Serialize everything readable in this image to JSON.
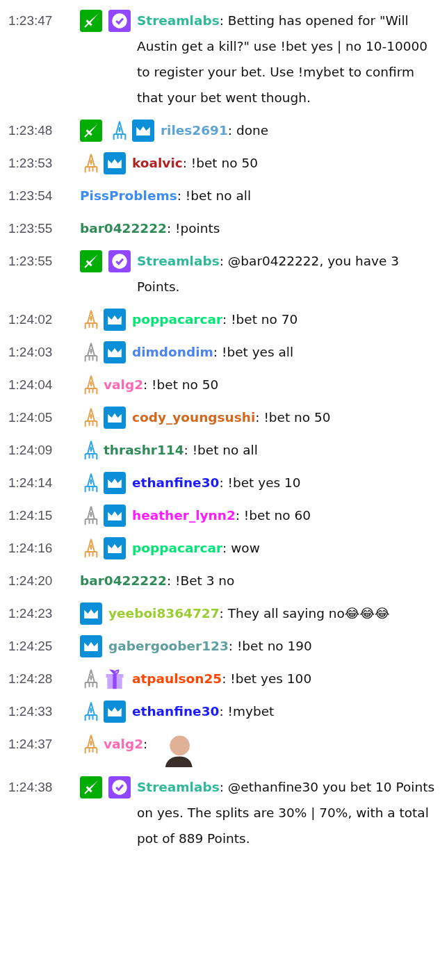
{
  "messages": [
    {
      "time": "1:23:47",
      "badges": [
        {
          "kind": "moderator"
        },
        {
          "kind": "verified"
        }
      ],
      "user": "Streamlabs",
      "color": "#2fb99a",
      "text": ": Betting has opened for \"Will Austin get a kill?\" use !bet yes | no 10-10000 to register your bet. Use !mybet to confirm that your bet went though."
    },
    {
      "time": "1:23:48",
      "badges": [
        {
          "kind": "moderator"
        },
        {
          "kind": "bits",
          "color": "#2ca4e8"
        },
        {
          "kind": "subscriber"
        }
      ],
      "user": "riles2691",
      "color": "#5fa3d3",
      "text": ": done"
    },
    {
      "time": "1:23:53",
      "badges": [
        {
          "kind": "bits",
          "color": "#e8a04c"
        },
        {
          "kind": "subscriber"
        }
      ],
      "user": "koalvic",
      "color": "#b22222",
      "text": ": !bet no 50"
    },
    {
      "time": "1:23:54",
      "user": "PissProblems",
      "color": "#3d8cf2",
      "text": ": !bet no all"
    },
    {
      "time": "1:23:55",
      "user": "bar0422222",
      "color": "#2e8b57",
      "text": ": !points"
    },
    {
      "time": "1:23:55",
      "badges": [
        {
          "kind": "moderator"
        },
        {
          "kind": "verified"
        }
      ],
      "user": "Streamlabs",
      "color": "#2fb99a",
      "text": ": @bar0422222, you have 3 Points."
    },
    {
      "time": "1:24:02",
      "badges": [
        {
          "kind": "bits",
          "color": "#e8a04c"
        },
        {
          "kind": "subscriber"
        }
      ],
      "user": "poppacarcar",
      "color": "#00e676",
      "text": ": !bet no 70"
    },
    {
      "time": "1:24:03",
      "badges": [
        {
          "kind": "bits",
          "color": "#9b9b9b"
        },
        {
          "kind": "subscriber"
        }
      ],
      "user": "dimdondim",
      "color": "#4b84ee",
      "text": ": !bet yes all"
    },
    {
      "time": "1:24:04",
      "badges": [
        {
          "kind": "bits",
          "color": "#e8a04c"
        }
      ],
      "user": "valg2",
      "color": "#ff69b4",
      "text": ": !bet no 50"
    },
    {
      "time": "1:24:05",
      "badges": [
        {
          "kind": "bits",
          "color": "#e8a04c"
        },
        {
          "kind": "subscriber"
        }
      ],
      "user": "cody_youngsushi",
      "color": "#d2691e",
      "text": ": !bet no 50"
    },
    {
      "time": "1:24:09",
      "badges": [
        {
          "kind": "bits",
          "color": "#2ca4e8"
        }
      ],
      "user": "thrashr114",
      "color": "#2e8b57",
      "text": ": !bet no all"
    },
    {
      "time": "1:24:14",
      "badges": [
        {
          "kind": "bits",
          "color": "#2ca4e8"
        },
        {
          "kind": "subscriber"
        }
      ],
      "user": "ethanfine30",
      "color": "#1a1aff",
      "text": ": !bet yes 10"
    },
    {
      "time": "1:24:15",
      "badges": [
        {
          "kind": "bits",
          "color": "#9b9b9b"
        },
        {
          "kind": "subscriber"
        }
      ],
      "user": "heather_lynn2",
      "color": "#ff1aff",
      "text": ": !bet no 60"
    },
    {
      "time": "1:24:16",
      "badges": [
        {
          "kind": "bits",
          "color": "#e8a04c"
        },
        {
          "kind": "subscriber"
        }
      ],
      "user": "poppacarcar",
      "color": "#00e676",
      "text": ": wow"
    },
    {
      "time": "1:24:20",
      "user": "bar0422222",
      "color": "#2e8b57",
      "text": ": !Bet 3 no"
    },
    {
      "time": "1:24:23",
      "badges": [
        {
          "kind": "subscriber"
        }
      ],
      "user": "yeeboi8364727",
      "color": "#9acd32",
      "text": ": They all saying no😂😂😂"
    },
    {
      "time": "1:24:25",
      "badges": [
        {
          "kind": "subscriber"
        }
      ],
      "user": "gabergoober123",
      "color": "#5f9ea0",
      "text": ": !bet no 190"
    },
    {
      "time": "1:24:28",
      "badges": [
        {
          "kind": "bits",
          "color": "#9b9b9b"
        },
        {
          "kind": "gift"
        }
      ],
      "user": "atpaulson25",
      "color": "#ff4500",
      "text": ": !bet yes 100"
    },
    {
      "time": "1:24:33",
      "badges": [
        {
          "kind": "bits",
          "color": "#2ca4e8"
        },
        {
          "kind": "subscriber"
        }
      ],
      "user": "ethanfine30",
      "color": "#1a1aff",
      "text": ": !mybet"
    },
    {
      "time": "1:24:37",
      "badges": [
        {
          "kind": "bits",
          "color": "#e8a04c"
        }
      ],
      "user": "valg2",
      "color": "#ff69b4",
      "text": ":",
      "emote": true
    },
    {
      "time": "1:24:38",
      "badges": [
        {
          "kind": "moderator"
        },
        {
          "kind": "verified"
        }
      ],
      "user": "Streamlabs",
      "color": "#2fb99a",
      "text": ": @ethanfine30 you bet 10 Points on yes. The splits are 30% | 70%, with a total pot of 889 Points."
    }
  ]
}
